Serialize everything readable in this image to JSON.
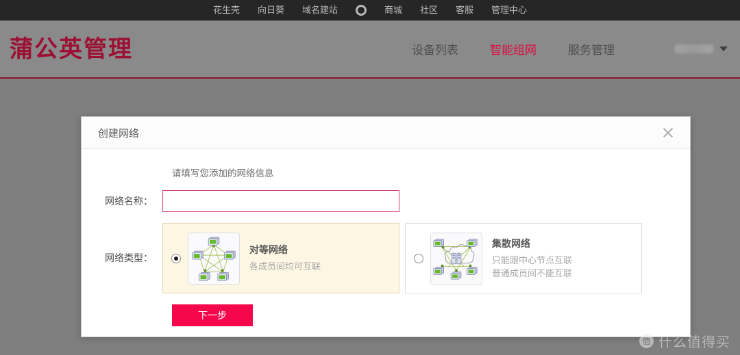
{
  "topbar": {
    "links": [
      {
        "label": "花生壳"
      },
      {
        "label": "向日葵"
      },
      {
        "label": "域名建站"
      }
    ],
    "icon": "ring-icon",
    "links_after": [
      {
        "label": "商城"
      },
      {
        "label": "社区"
      },
      {
        "label": "客服"
      },
      {
        "label": "管理中心"
      }
    ]
  },
  "header": {
    "logo": "蒲公英管理",
    "nav": [
      {
        "label": "设备列表",
        "active": false
      },
      {
        "label": "智能组网",
        "active": true
      },
      {
        "label": "服务管理",
        "active": false
      }
    ],
    "user": {
      "name_masked": "",
      "caret": "chevron-down-icon"
    }
  },
  "modal": {
    "title": "创建网络",
    "close_label": "×",
    "hint": "请填写您添加的网络信息",
    "fields": {
      "network_name": {
        "label": "网络名称：",
        "value": "",
        "placeholder": ""
      },
      "network_type": {
        "label": "网络类型：",
        "options": [
          {
            "id": "p2p",
            "name": "对等网络",
            "desc_lines": [
              "各成员间均可互联"
            ],
            "selected": true,
            "icon": "mesh-network-icon"
          },
          {
            "id": "hub",
            "name": "集散网络",
            "desc_lines": [
              "只能跟中心节点互联",
              "普通成员间不能互联"
            ],
            "selected": false,
            "icon": "hub-spoke-network-icon"
          }
        ]
      }
    },
    "next_button": "下一步"
  },
  "watermark": {
    "badge": "值",
    "text": "什么值得买"
  },
  "colors": {
    "topbar_bg": "#262626",
    "header_bg": "#8a8a8a",
    "brand_red": "#9c1033",
    "accent_pink": "#f5074c",
    "active_nav": "#e00b3c",
    "selected_card_bg": "#fdf6e3",
    "input_border": "#d6407a",
    "page_bg": "#7f7f7f"
  }
}
